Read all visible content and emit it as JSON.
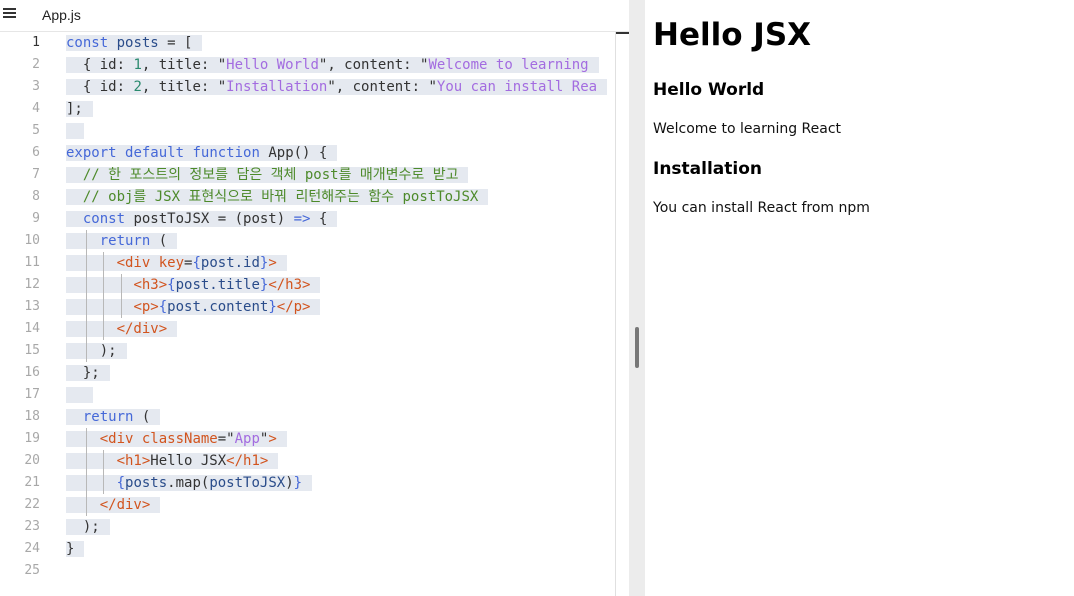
{
  "editor": {
    "tab_label": "App.js",
    "line_numbers": [
      "1",
      "2",
      "3",
      "4",
      "5",
      "6",
      "7",
      "8",
      "9",
      "10",
      "11",
      "12",
      "13",
      "14",
      "15",
      "16",
      "17",
      "18",
      "19",
      "20",
      "21",
      "22",
      "23",
      "24",
      "25"
    ],
    "active_line": "1"
  },
  "code": {
    "l1": {
      "kw": "const",
      "var": "posts",
      "rest": " = ["
    },
    "l2": {
      "a": "{ id: ",
      "n": "1",
      "b": ", title: \"",
      "s1": "Hello World",
      "c": "\", content: \"",
      "s2": "Welcome to learning"
    },
    "l3": {
      "a": "{ id: ",
      "n": "2",
      "b": ", title: \"",
      "s1": "Installation",
      "c": "\", content: \"",
      "s2": "You can install Rea"
    },
    "l4": "];",
    "l6": {
      "k1": "export",
      "k2": "default",
      "k3": "function",
      "rest": " App() {"
    },
    "l7": "// 한 포스트의 정보를 담은 객체 post를 매개변수로 받고",
    "l8": "// obj를 JSX 표현식으로 바꿔 리턴해주는 함수 postToJSX",
    "l9": {
      "kw": "const",
      "a": " postToJSX = (post) ",
      "arrow": "=>",
      "b": " {"
    },
    "l10": {
      "kw": "return",
      "b": " ("
    },
    "l11": {
      "lt": "<div ",
      "attr": "key",
      "eq": "=",
      "ob": "{",
      "v": "post.id",
      "cb": "}",
      "gt": ">"
    },
    "l12": {
      "o": "<h3>",
      "ob": "{",
      "v": "post.title",
      "cb": "}",
      "c": "</h3>"
    },
    "l13": {
      "o": "<p>",
      "ob": "{",
      "v": "post.content",
      "cb": "}",
      "c": "</p>"
    },
    "l14": "</div>",
    "l15": ");",
    "l16": "};",
    "l18": {
      "kw": "return",
      "b": " ("
    },
    "l19": {
      "lt": "<div ",
      "attr": "className",
      "eq": "=\"",
      "s": "App",
      "q": "\"",
      "gt": ">"
    },
    "l20": {
      "o": "<h1>",
      "t": "Hello JSX",
      "c": "</h1>"
    },
    "l21": {
      "ob": "{",
      "v": "posts",
      "m": ".map(",
      "v2": "postToJSX",
      "p": ")",
      "cb": "}"
    },
    "l22": "</div>",
    "l23": ");",
    "l24": "}"
  },
  "preview": {
    "heading": "Hello JSX",
    "posts": [
      {
        "title": "Hello World",
        "content": "Welcome to learning React"
      },
      {
        "title": "Installation",
        "content": "You can install React from npm"
      }
    ]
  }
}
